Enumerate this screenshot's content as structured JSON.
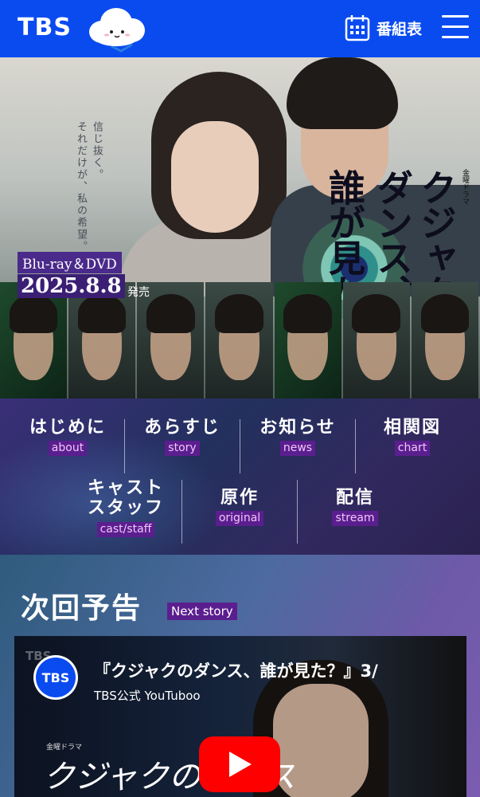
{
  "header": {
    "logo": "TBS",
    "schedule_label": "番組表"
  },
  "hero": {
    "taglines": [
      "信じ抜く。",
      "それだけが、私の希望。"
    ],
    "drama_label": "金曜ドラマ",
    "title_lines": [
      "クジャクの",
      "ダンス、",
      "誰が見た？"
    ],
    "bluray_label": "Blu-ray＆DVD",
    "release_date": "2025.8.8",
    "release_suffix": "発売"
  },
  "nav": {
    "items": [
      {
        "jp": "はじめに",
        "en": "about"
      },
      {
        "jp": "あらすじ",
        "en": "story"
      },
      {
        "jp": "お知らせ",
        "en": "news"
      },
      {
        "jp": "相関図",
        "en": "chart"
      },
      {
        "jp": "キャスト\nスタッフ",
        "en": "cast/staff"
      },
      {
        "jp": "原作",
        "en": "original"
      },
      {
        "jp": "配信",
        "en": "stream"
      }
    ]
  },
  "next_story": {
    "title": "次回予告",
    "title_en": "Next story"
  },
  "video": {
    "channel_avatar": "TBS",
    "title": "『クジャクのダンス、誰が見た？』3/",
    "channel": "TBS公式 YouTuboo",
    "watermark": "TBS",
    "drama_label": "金曜ドラマ",
    "show_title": "クジャクのダンス"
  },
  "colors": {
    "header_bg": "#0a4bf0",
    "label_purple": "#5b1e8f",
    "youtube_red": "#ff0000"
  }
}
